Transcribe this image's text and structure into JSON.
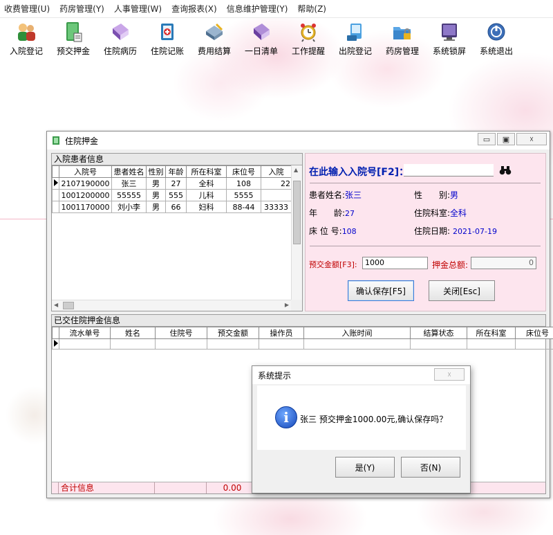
{
  "menu": [
    "收费管理(U)",
    "药房管理(Y)",
    "人事管理(W)",
    "查询报表(X)",
    "信息维护管理(Y)",
    "帮助(Z)"
  ],
  "toolbar": [
    {
      "label": "入院登记",
      "icon": "users-icon"
    },
    {
      "label": "预交押金",
      "icon": "book-deposit-icon"
    },
    {
      "label": "住院病历",
      "icon": "book-icon"
    },
    {
      "label": "住院记账",
      "icon": "ledger-icon"
    },
    {
      "label": "费用结算",
      "icon": "calculator-icon"
    },
    {
      "label": "一日清单",
      "icon": "list-book-icon"
    },
    {
      "label": "工作提醒",
      "icon": "alarm-clock-icon"
    },
    {
      "label": "出院登记",
      "icon": "computer-icon"
    },
    {
      "label": "药房管理",
      "icon": "folder-lock-icon"
    },
    {
      "label": "系统锁屏",
      "icon": "monitor-icon"
    },
    {
      "label": "系统退出",
      "icon": "power-icon"
    }
  ],
  "window": {
    "title": "住院押金",
    "min": "▭",
    "max": "▣",
    "close": "☓"
  },
  "patients": {
    "caption": "入院患者信息",
    "headers": [
      "入院号",
      "患者姓名",
      "性别",
      "年龄",
      "所在科室",
      "床位号",
      "入院"
    ],
    "rows": [
      [
        "2107190000",
        "张三",
        "男",
        "27",
        "全科",
        "108",
        "22"
      ],
      [
        "1001200000",
        "55555",
        "男",
        "555",
        "儿科",
        "5555",
        ""
      ],
      [
        "1001170000",
        "刘小李",
        "男",
        "66",
        "妇科",
        "88-44",
        "33333"
      ]
    ]
  },
  "form": {
    "prompt": "在此输入入院号[F2]：",
    "name_label": "患者姓名:",
    "name": "张三",
    "sex_label": "性　　别:",
    "sex": "男",
    "age_label": "年　　龄:",
    "age": "27",
    "dept_label": "住院科室:",
    "dept": "全科",
    "bed_label": "床 位 号:",
    "bed": "108",
    "date_label": "住院日期:",
    "date": "2021-07-19",
    "amount_label": "预交金额[F3]:",
    "amount": "1000",
    "total_label": "押金总额:",
    "total": "0",
    "save_btn": "确认保存[F5]",
    "close_btn": "关闭[Esc]"
  },
  "deposits": {
    "caption": "已交住院押金信息",
    "headers": [
      "流水单号",
      "姓名",
      "住院号",
      "预交金额",
      "操作员",
      "入账时间",
      "结算状态",
      "所在科室",
      "床位号"
    ],
    "sum_label": "合计信息",
    "sum_value": "0.00"
  },
  "dialog": {
    "title": "系统提示",
    "close": "☓",
    "message": "张三 预交押金1000.00元,确认保存吗？",
    "yes": "是(Y)",
    "no": "否(N)"
  }
}
